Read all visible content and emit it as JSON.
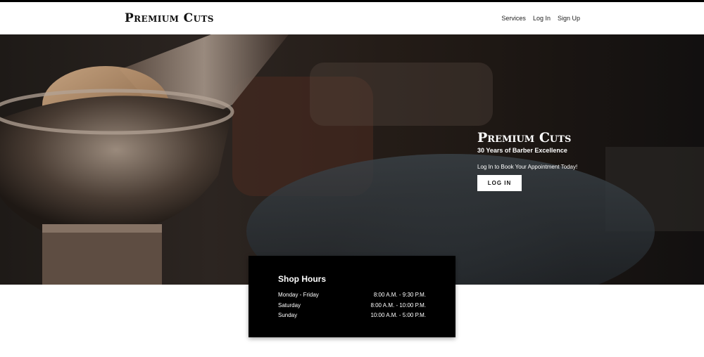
{
  "brand": {
    "name": "Premium Cuts"
  },
  "nav": {
    "links": [
      "Services",
      "Log In",
      "Sign Up"
    ]
  },
  "hero": {
    "title": "Premium Cuts",
    "subtitle": "30 Years of Barber Excellence",
    "cta_text": "Log In to Book Your Appointment Today!",
    "login_button": "LOG IN"
  },
  "hours": {
    "title": "Shop Hours",
    "rows": [
      {
        "day": "Monday - Friday",
        "time": "8:00 A.M. - 9:30 P.M."
      },
      {
        "day": "Saturday",
        "time": "8:00 A.M. - 10:00 P.M."
      },
      {
        "day": "Sunday",
        "time": "10:00 A.M. - 5:00 P.M."
      }
    ]
  },
  "colors": {
    "hero_bg": "#241c17",
    "card_bg": "#000000",
    "text": "#ffffff"
  }
}
